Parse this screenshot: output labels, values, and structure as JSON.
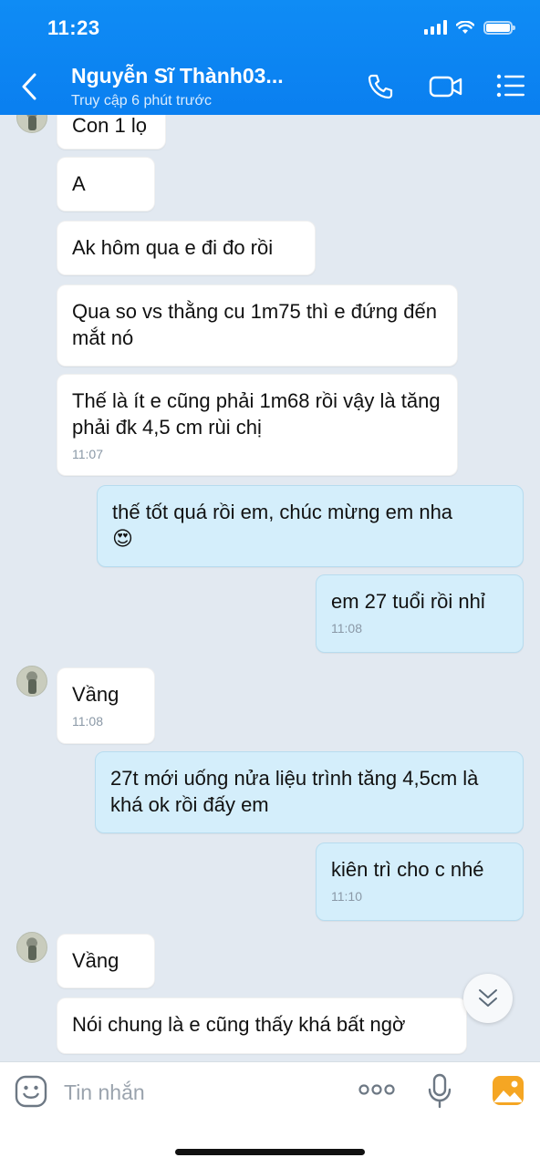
{
  "status_bar": {
    "time": "11:23"
  },
  "header": {
    "contact_name": "Nguyễn Sĩ Thành03...",
    "last_seen": "Truy cập 6 phút trước"
  },
  "messages": [
    {
      "direction": "in",
      "text": "Con 1 lọ"
    },
    {
      "direction": "in",
      "text": "A"
    },
    {
      "direction": "in",
      "text": "Ak hôm qua e đi đo rồi"
    },
    {
      "direction": "in",
      "text": "Qua so vs thằng cu 1m75 thì e đứng đến mắt nó"
    },
    {
      "direction": "in",
      "text": "Thế là ít e cũng phải 1m68 rồi vậy là tăng phải đk 4,5 cm rùi chị",
      "time": "11:07"
    },
    {
      "direction": "out",
      "text": "thế tốt quá rồi em, chúc mừng em nha",
      "emoji": "😍"
    },
    {
      "direction": "out",
      "text": "em 27 tuổi rồi nhỉ",
      "time": "11:08"
    },
    {
      "direction": "in",
      "text": "Vầng",
      "time": "11:08"
    },
    {
      "direction": "out",
      "text": "27t mới uống nửa liệu trình tăng 4,5cm là khá ok rồi đấy em"
    },
    {
      "direction": "out",
      "text": "kiên trì cho c nhé",
      "time": "11:10"
    },
    {
      "direction": "in",
      "text": "Vầng"
    },
    {
      "direction": "in",
      "text": "Nói chung là e cũng thấy khá bất ngờ"
    }
  ],
  "composer": {
    "placeholder": "Tin nhắn"
  },
  "icons": [
    "back-icon",
    "call-icon",
    "video-icon",
    "menu-icon",
    "chevron-down-icon",
    "emoji-icon",
    "more-icon",
    "mic-icon",
    "photo-icon"
  ],
  "colors": {
    "header": "#0a7ff0",
    "incoming_bubble": "#ffffff",
    "outgoing_bubble": "#d4eefb",
    "chat_background": "#e2e9f1"
  }
}
